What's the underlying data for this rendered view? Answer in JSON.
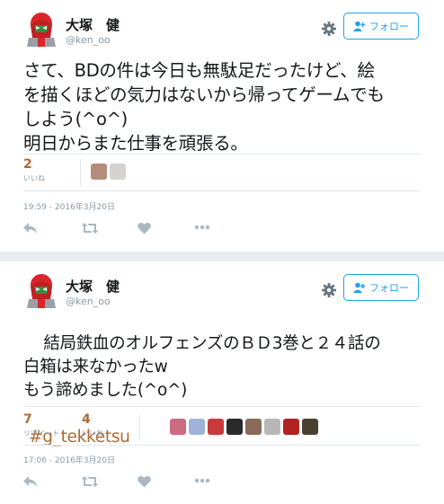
{
  "tweets": [
    {
      "author": {
        "name": "大塚　健",
        "handle": "@ken_oo"
      },
      "follow_label": "フォロー",
      "text": "さて、BDの件は今日も無駄足だったけど、絵\nを描くほどの気力はないから帰ってゲームでも\nしよう(^o^)\n明日からまた仕事を頑張る。",
      "hashtag": "",
      "stats": [
        {
          "count": "2",
          "label": "いいね"
        }
      ],
      "liker_colors": [
        "#b48c7c",
        "#d6d2cf"
      ],
      "timestamp": "19:59 - 2016年3月20日"
    },
    {
      "author": {
        "name": "大塚　健",
        "handle": "@ken_oo"
      },
      "follow_label": "フォロー",
      "text": "結局鉄血のオルフェンズのＢＤ3巻と２４話の\n白箱は来なかったw\nもう諦めました(^o^)",
      "hashtag": "#g_tekketsu",
      "stats": [
        {
          "count": "7",
          "label": "リツイート"
        },
        {
          "count": "4",
          "label": "いいね"
        }
      ],
      "liker_colors": [
        "#cc6b84",
        "#9fb3d9",
        "#c93a3a",
        "#2a2a2a",
        "#8a6a5a",
        "#b8b8b8",
        "#b22222",
        "#4a4030"
      ],
      "timestamp": "17:06 - 2016年3月20日"
    }
  ],
  "icons": [
    "reply-icon",
    "retweet-icon",
    "heart-icon",
    "more-icon",
    "gear-icon",
    "follow-user-icon"
  ],
  "colors": {
    "accent": "#1da1f2",
    "count": "#b06a32",
    "muted": "#8899a6",
    "separator": "#e6ecf0"
  }
}
